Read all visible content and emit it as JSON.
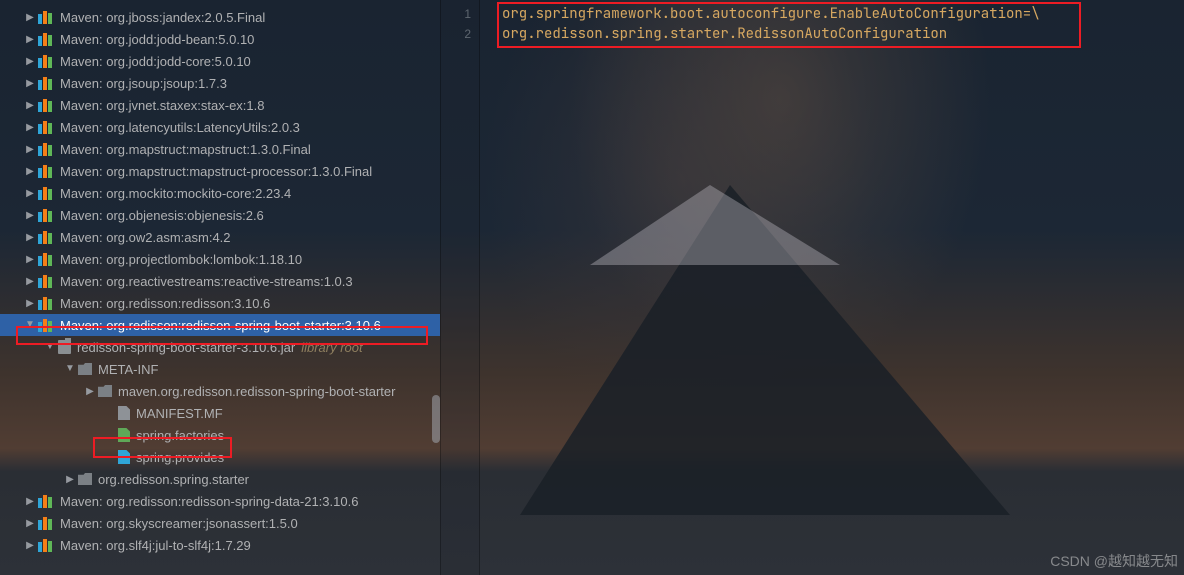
{
  "tree": {
    "items": [
      {
        "depth": 1,
        "arrow": "right",
        "icon": "lib",
        "label": "Maven: org.jboss:jandex:2.0.5.Final"
      },
      {
        "depth": 1,
        "arrow": "right",
        "icon": "lib",
        "label": "Maven: org.jodd:jodd-bean:5.0.10"
      },
      {
        "depth": 1,
        "arrow": "right",
        "icon": "lib",
        "label": "Maven: org.jodd:jodd-core:5.0.10"
      },
      {
        "depth": 1,
        "arrow": "right",
        "icon": "lib",
        "label": "Maven: org.jsoup:jsoup:1.7.3"
      },
      {
        "depth": 1,
        "arrow": "right",
        "icon": "lib",
        "label": "Maven: org.jvnet.staxex:stax-ex:1.8"
      },
      {
        "depth": 1,
        "arrow": "right",
        "icon": "lib",
        "label": "Maven: org.latencyutils:LatencyUtils:2.0.3"
      },
      {
        "depth": 1,
        "arrow": "right",
        "icon": "lib",
        "label": "Maven: org.mapstruct:mapstruct:1.3.0.Final"
      },
      {
        "depth": 1,
        "arrow": "right",
        "icon": "lib",
        "label": "Maven: org.mapstruct:mapstruct-processor:1.3.0.Final"
      },
      {
        "depth": 1,
        "arrow": "right",
        "icon": "lib",
        "label": "Maven: org.mockito:mockito-core:2.23.4"
      },
      {
        "depth": 1,
        "arrow": "right",
        "icon": "lib",
        "label": "Maven: org.objenesis:objenesis:2.6"
      },
      {
        "depth": 1,
        "arrow": "right",
        "icon": "lib",
        "label": "Maven: org.ow2.asm:asm:4.2"
      },
      {
        "depth": 1,
        "arrow": "right",
        "icon": "lib",
        "label": "Maven: org.projectlombok:lombok:1.18.10"
      },
      {
        "depth": 1,
        "arrow": "right",
        "icon": "lib",
        "label": "Maven: org.reactivestreams:reactive-streams:1.0.3"
      },
      {
        "depth": 1,
        "arrow": "right",
        "icon": "lib",
        "label": "Maven: org.redisson:redisson:3.10.6"
      },
      {
        "depth": 1,
        "arrow": "down",
        "icon": "lib",
        "label": "Maven: org.redisson:redisson-spring-boot-starter:3.10.6",
        "selected": true
      },
      {
        "depth": 2,
        "arrow": "down",
        "icon": "jar",
        "label": "redisson-spring-boot-starter-3.10.6.jar",
        "libroot": "library root"
      },
      {
        "depth": 3,
        "arrow": "down",
        "icon": "folder",
        "label": "META-INF"
      },
      {
        "depth": 4,
        "arrow": "right",
        "icon": "folder",
        "label": "maven.org.redisson.redisson-spring-boot-starter"
      },
      {
        "depth": 5,
        "arrow": "none",
        "icon": "file",
        "label": "MANIFEST.MF"
      },
      {
        "depth": 5,
        "arrow": "none",
        "icon": "file-green",
        "label": "spring.factories"
      },
      {
        "depth": 5,
        "arrow": "none",
        "icon": "file-teal",
        "label": "spring.provides"
      },
      {
        "depth": 3,
        "arrow": "right",
        "icon": "folder",
        "label": "org.redisson.spring.starter"
      },
      {
        "depth": 1,
        "arrow": "right",
        "icon": "lib",
        "label": "Maven: org.redisson:redisson-spring-data-21:3.10.6"
      },
      {
        "depth": 1,
        "arrow": "right",
        "icon": "lib",
        "label": "Maven: org.skyscreamer:jsonassert:1.5.0"
      },
      {
        "depth": 1,
        "arrow": "right",
        "icon": "lib",
        "label": "Maven: org.slf4j:jul-to-slf4j:1.7.29"
      }
    ]
  },
  "gutter": {
    "line1": "1",
    "line2": "2"
  },
  "editor": {
    "line1": "org.springframework.boot.autoconfigure.EnableAutoConfiguration=\\",
    "line2": "org.redisson.spring.starter.RedissonAutoConfiguration"
  },
  "watermark": "CSDN @越知越无知"
}
